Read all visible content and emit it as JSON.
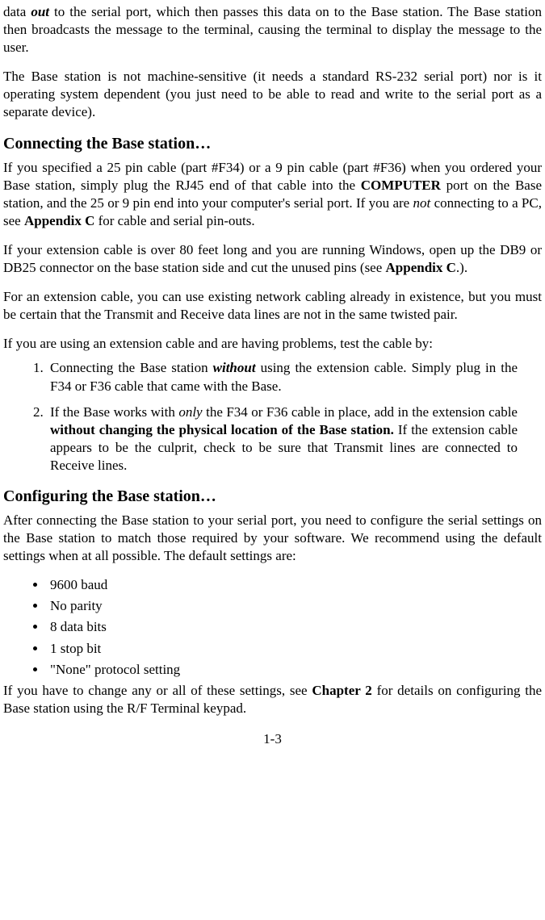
{
  "p1_a": "data ",
  "p1_b": "out",
  "p1_c": " to the serial port, which then passes this data on to the Base station. The Base station then broadcasts the message to the terminal, causing the terminal to display the message to the user.",
  "p2": "The Base station is not machine-sensitive (it needs a standard RS-232 serial port) nor is it operating system dependent (you just need to be able to read and write to the serial port as a separate device).",
  "h1": "Connecting the Base station…",
  "p3_a": "If you specified a 25 pin cable (part #F34) or a 9 pin cable (part #F36) when you ordered your Base station, simply plug the RJ45 end of that cable into the ",
  "p3_b": "COMPUTER",
  "p3_c": " port on the Base station, and the 25 or 9 pin end into your computer's serial port. If you are ",
  "p3_d": "not",
  "p3_e": " connecting to a PC, see ",
  "p3_f": "Appendix C",
  "p3_g": " for cable and serial pin-outs.",
  "p4_a": "If your extension cable is over 80 feet long and you are running Windows, open up the DB9 or DB25 connector on the base station side and cut the unused pins (see ",
  "p4_b": "Appendix C",
  "p4_c": ".).",
  "p5": "For an extension cable, you can use existing network cabling already in existence, but you must be certain that the Transmit and Receive data lines are not in the same twisted pair.",
  "p6": "If you are using an extension cable and are having problems, test the cable by:",
  "li1_a": "Connecting the Base station ",
  "li1_b": "without",
  "li1_c": " using the extension cable. Simply plug in the F34 or F36 cable that came with the Base.",
  "li2_a": "If the Base works with ",
  "li2_b": "only",
  "li2_c": " the F34 or F36 cable in place, add in the extension cable ",
  "li2_d": "without changing the physical location of the Base station.",
  "li2_e": " If the extension cable appears to be the culprit, check to be sure that Transmit lines are connected to Receive lines.",
  "h2": "Configuring the Base station…",
  "p7": "After connecting the Base station to your serial port, you need to configure the serial settings on the Base station to match those required by your software.  We recommend using the default settings when at all possible.  The default settings are:",
  "b1": "9600 baud",
  "b2": "No parity",
  "b3": "8 data bits",
  "b4": "1 stop bit",
  "b5": "\"None\" protocol setting",
  "p8_a": "If you have to change any or all of these settings, see ",
  "p8_b": "Chapter 2",
  "p8_c": " for details on configuring the Base station using the R/F Terminal keypad.",
  "footer": "1-3"
}
